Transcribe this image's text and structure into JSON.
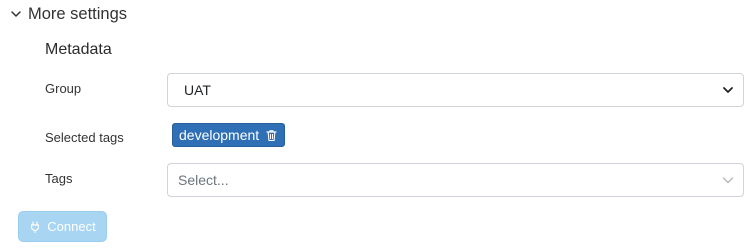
{
  "more_settings": {
    "toggle_label": "More settings",
    "toggle_icon": "chevron-down-icon"
  },
  "metadata": {
    "title": "Metadata",
    "group": {
      "label": "Group",
      "value": "UAT",
      "icon": "chevron-down-icon"
    },
    "selected_tags": {
      "label": "Selected tags",
      "items": [
        {
          "label": "development",
          "icon": "trash-icon"
        }
      ]
    },
    "tags": {
      "label": "Tags",
      "placeholder": "Select...",
      "icon": "chevron-down-icon"
    }
  },
  "actions": {
    "connect_label": "Connect",
    "connect_icon": "plug-icon"
  },
  "colors": {
    "tag_bg": "#2e6fb5",
    "connect_bg": "#a8d5f2"
  }
}
